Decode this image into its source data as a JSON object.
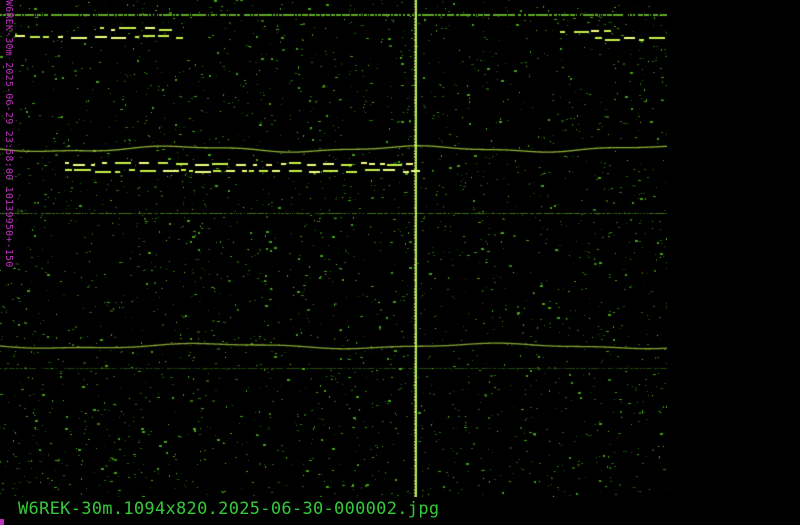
{
  "image": {
    "vertical_label": "W6REK-30m 2025-06-29 23:58:00 10139950+-150",
    "filename_caption": "W6REK-30m.1094x820.2025-06-30-000002.jpg"
  },
  "colors": {
    "background": "#000000",
    "noise": "#2f8a12",
    "noise_bright": "#5fc21c",
    "signal": "#c9f24a",
    "signal_hot": "#f4ff86",
    "label_magenta": "#c030c0",
    "caption_green": "#34c93a"
  }
}
